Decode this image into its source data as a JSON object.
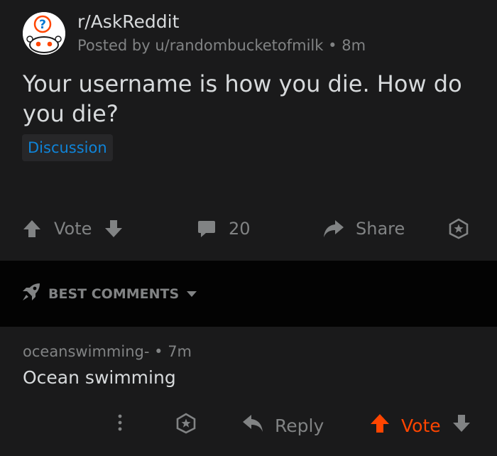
{
  "post": {
    "subreddit": "r/AskReddit",
    "meta_prefix": "Posted by",
    "author": "u/randombucketofmilk",
    "age": "8m",
    "title": "Your username is how you die. How do you die?",
    "flair": "Discussion",
    "vote_label": "Vote",
    "comment_count": "20",
    "share_label": "Share"
  },
  "sort": {
    "label": "BEST COMMENTS"
  },
  "comment": {
    "author": "oceanswimming-",
    "age": "7m",
    "body": "Ocean swimming",
    "reply_label": "Reply",
    "vote_label": "Vote"
  },
  "colors": {
    "background": "#1a1a1b",
    "separator": "#030303",
    "text": "#d7dadc",
    "muted": "#818384",
    "link": "#0f84d8",
    "upvote": "#ff4500"
  },
  "separator_dot": "•"
}
